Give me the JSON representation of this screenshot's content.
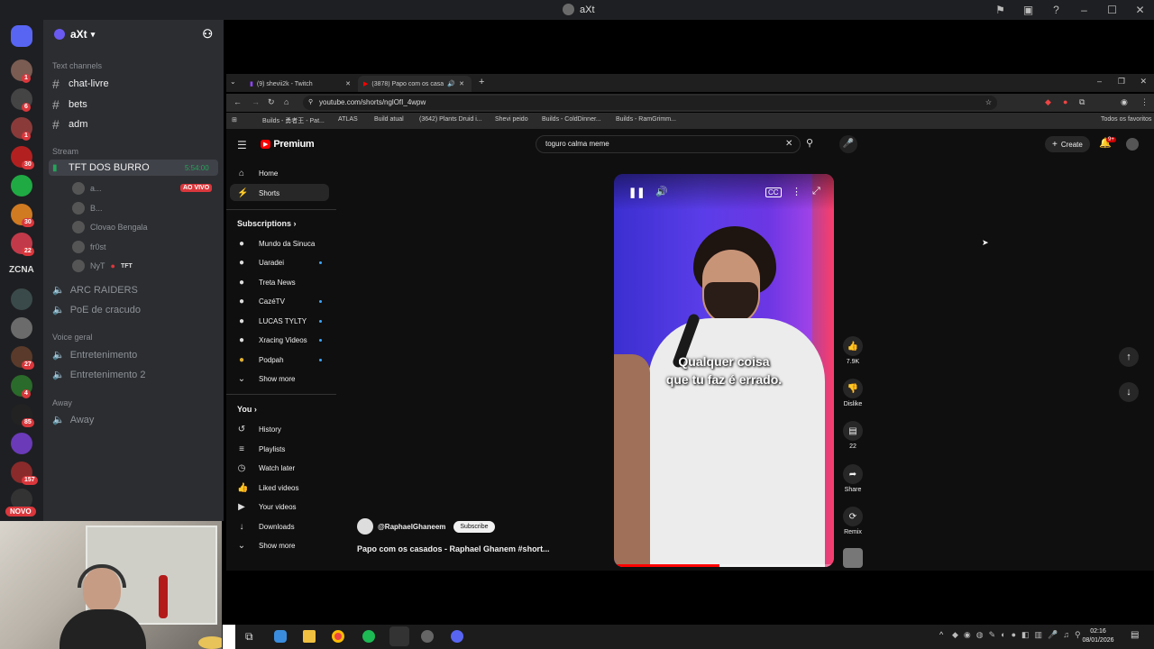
{
  "window": {
    "title": "aXt"
  },
  "server": {
    "name": "aXt"
  },
  "rail_badges": [
    "1",
    "6",
    "1",
    "30",
    "8",
    "30",
    "22",
    "27",
    "4",
    "85",
    "157"
  ],
  "rail_labels": {
    "zcna": "ZCNA",
    "novo": "NOVO"
  },
  "channels": {
    "text_category": "Text channels",
    "text": [
      "chat-livre",
      "bets",
      "adm"
    ],
    "stream_category": "Stream",
    "stream_channel": "TFT DOS BURRO",
    "stream_timer": "5:54:00",
    "live_badge": "AO VIVO",
    "stream_users": [
      "a...",
      "B...",
      "Clovao Bengala",
      "fr0st",
      "NyT"
    ],
    "nyt_game": "TFT",
    "other_voice": [
      "ARC RAIDERS",
      "PoE de cracudo"
    ],
    "voice_category": "Voice geral",
    "voice": [
      "Entretenimento",
      "Entretenimento 2"
    ],
    "away_category": "Away",
    "away": [
      "Away"
    ]
  },
  "browser": {
    "tabs": [
      "(9) shevii2k - Twitch",
      "(3878) Papo com os casado"
    ],
    "url": "youtube.com/shorts/nglOfI_4wpw",
    "bookmarks": [
      "Builds - 勇者王 - Pat...",
      "ATLAS",
      "Build atual",
      "(3642) Plants Druid i...",
      "Shevi peido",
      "Builds - ColdDinner...",
      "Builds - RamGrimm..."
    ],
    "all_bookmarks": "Todos os favoritos"
  },
  "youtube": {
    "logo": "Premium",
    "search_value": "toguro calma meme",
    "create_label": "Create",
    "notif_count": "9+",
    "nav": [
      "Home",
      "Shorts"
    ],
    "subs_header": "Subscriptions",
    "subs": [
      "Mundo da Sinuca",
      "Uaradei",
      "Treta News",
      "CazéTV",
      "LUCAS TYLTY",
      "Xracing Videos",
      "Podpah"
    ],
    "show_more": "Show more",
    "you_header": "You",
    "you": [
      "History",
      "Playlists",
      "Watch later",
      "Liked videos",
      "Your videos",
      "Downloads"
    ],
    "channel_handle": "@RaphaelGhaneem",
    "subscribe_label": "Subscribe",
    "video_title": "Papo com os casados - Raphael Ghanem #short...",
    "caption_line1": "Qualquer coisa",
    "caption_line2": "que tu faz é errado.",
    "likes": "7.9K",
    "dislike_label": "Dislike",
    "comments": "22",
    "share_label": "Share",
    "remix_label": "Remix"
  },
  "clock": {
    "time": "02:16",
    "date": "08/01/2026"
  },
  "colors": {
    "discord_bg": "#2b2d31",
    "live_red": "#da373c",
    "yt_bg": "#0f0f0f"
  }
}
